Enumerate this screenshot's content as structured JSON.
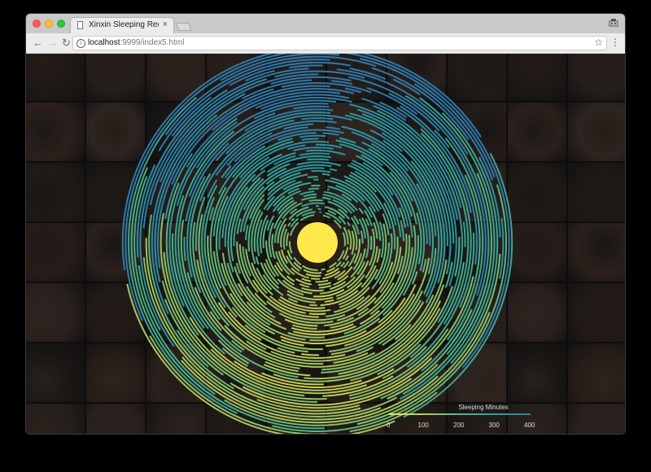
{
  "browser": {
    "tab_title": "Xinxin Sleeping Records",
    "tab_close": "×",
    "url_host": "localhost",
    "url_rest": ":9999/index5.html",
    "icons": {
      "close": "close-icon",
      "minimize": "minimize-icon",
      "maximize": "maximize-icon",
      "back": "back-icon",
      "forward": "forward-icon",
      "reload": "reload-icon",
      "info": "info-icon",
      "star": "star-icon",
      "menu": "menu-icon",
      "extension": "extension-icon"
    }
  },
  "legend": {
    "title": "Sleeping Minutes",
    "ticks": [
      "0",
      "100",
      "200",
      "300",
      "400"
    ],
    "tick_values": [
      0,
      100,
      200,
      300,
      400
    ],
    "domain": [
      0,
      400
    ],
    "colors": [
      "#fde34d",
      "#a8cf62",
      "#4fb98c",
      "#2a9fa6",
      "#2f7fb4"
    ]
  },
  "colors": {
    "center": "#ffe94a",
    "background": "#0d0d0d"
  },
  "photo_grid": {
    "tones": [
      "#5a3c30",
      "#4c372c",
      "#6b4a3c",
      "#3e2f28",
      "#73554a",
      "#584239",
      "#2f2723",
      "#66493e"
    ]
  }
}
